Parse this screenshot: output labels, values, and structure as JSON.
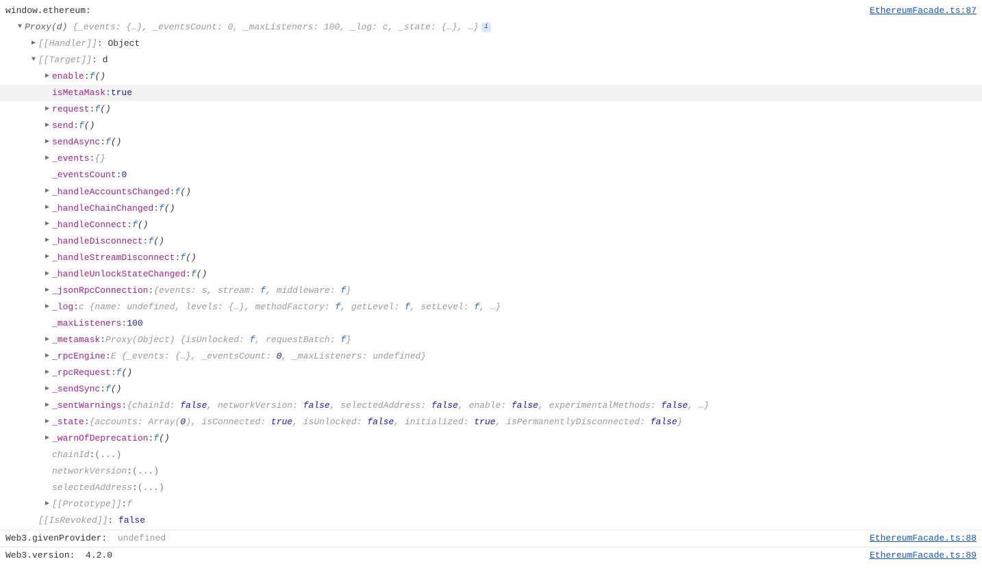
{
  "messages": [
    {
      "label": "window.ethereum:",
      "source": "EthereumFacade.ts:87"
    },
    {
      "label": "Web3.givenProvider:",
      "value": "undefined",
      "valueClass": "val-undef",
      "source": "EthereumFacade.ts:88"
    },
    {
      "label": "Web3.version:",
      "value": "4.2.0",
      "valueClass": "key-normal",
      "source": "EthereumFacade.ts:89"
    }
  ],
  "proxy": {
    "header": "Proxy(d)",
    "headerPreview": "{_events: {…}, _eventsCount: 0, _maxListeners: 100, _log: c, _state: {…}, …}",
    "infoGlyph": "i",
    "handler": {
      "key": "[[Handler]]",
      "value": "Object"
    },
    "target": {
      "key": "[[Target]]",
      "value": "d"
    },
    "isRevoked": {
      "key": "[[IsRevoked]]",
      "value": "false"
    }
  },
  "targetProps": [
    {
      "arrow": true,
      "key": "enable",
      "func": true
    },
    {
      "arrow": false,
      "key": "isMetaMask",
      "value": "true",
      "valueClass": "val-bool",
      "highlight": true
    },
    {
      "arrow": true,
      "key": "request",
      "func": true
    },
    {
      "arrow": true,
      "key": "send",
      "func": true
    },
    {
      "arrow": true,
      "key": "sendAsync",
      "func": true
    },
    {
      "arrow": true,
      "key": "_events",
      "value": "{}",
      "valueClass": "summary"
    },
    {
      "arrow": false,
      "key": "_eventsCount",
      "value": "0",
      "valueClass": "val-num"
    },
    {
      "arrow": true,
      "key": "_handleAccountsChanged",
      "func": true
    },
    {
      "arrow": true,
      "key": "_handleChainChanged",
      "func": true
    },
    {
      "arrow": true,
      "key": "_handleConnect",
      "func": true
    },
    {
      "arrow": true,
      "key": "_handleDisconnect",
      "func": true
    },
    {
      "arrow": true,
      "key": "_handleStreamDisconnect",
      "func": true
    },
    {
      "arrow": true,
      "key": "_handleUnlockStateChanged",
      "func": true
    },
    {
      "arrow": true,
      "key": "_jsonRpcConnection",
      "preview": "{events: s, stream: f, middleware: f}"
    },
    {
      "arrow": true,
      "key": "_log",
      "preview": "c {name: undefined, levels: {…}, methodFactory: f, getLevel: f, setLevel: f, …}"
    },
    {
      "arrow": false,
      "key": "_maxListeners",
      "value": "100",
      "valueClass": "val-num"
    },
    {
      "arrow": true,
      "key": "_metamask",
      "preview": "Proxy(Object) {isUnlocked: f, requestBatch: f}"
    },
    {
      "arrow": true,
      "key": "_rpcEngine",
      "preview": "E {_events: {…}, _eventsCount: 0, _maxListeners: undefined}"
    },
    {
      "arrow": true,
      "key": "_rpcRequest",
      "func": true
    },
    {
      "arrow": true,
      "key": "_sendSync",
      "func": true
    },
    {
      "arrow": true,
      "key": "_sentWarnings",
      "preview": "{chainId: false, networkVersion: false, selectedAddress: false, enable: false, experimentalMethods: false, …}"
    },
    {
      "arrow": true,
      "key": "_state",
      "preview": "{accounts: Array(0), isConnected: true, isUnlocked: false, initialized: true, isPermanentlyDisconnected: false}"
    },
    {
      "arrow": true,
      "key": "_warnOfDeprecation",
      "func": true
    },
    {
      "arrow": false,
      "key": "chainId",
      "value": "(...)",
      "valueClass": "lazy",
      "keyStyle": "summary"
    },
    {
      "arrow": false,
      "key": "networkVersion",
      "value": "(...)",
      "valueClass": "lazy",
      "keyStyle": "summary"
    },
    {
      "arrow": false,
      "key": "selectedAddress",
      "value": "(...)",
      "valueClass": "lazy",
      "keyStyle": "summary"
    },
    {
      "arrow": true,
      "key": "[[Prototype]]",
      "value": "f",
      "valueClass": "summary",
      "keyStyle": "summary"
    }
  ]
}
